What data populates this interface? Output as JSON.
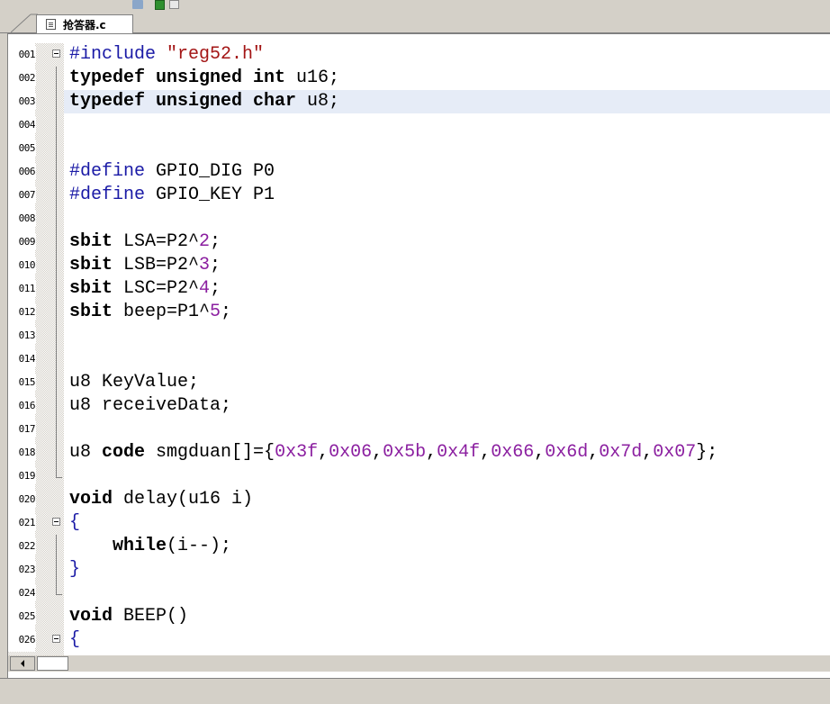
{
  "editor": {
    "tab_label": "抢答器.c",
    "highlighted_line": 3,
    "lines": [
      {
        "num": "001",
        "fold": "box",
        "parts": [
          {
            "t": "#include ",
            "c": "pp"
          },
          {
            "t": "\"reg52.h\"",
            "c": "str"
          }
        ]
      },
      {
        "num": "002",
        "fold": "line",
        "parts": [
          {
            "t": "typedef unsigned int ",
            "c": "kw"
          },
          {
            "t": "u16;",
            "c": ""
          }
        ]
      },
      {
        "num": "003",
        "fold": "line",
        "parts": [
          {
            "t": "typedef unsigned char ",
            "c": "kw"
          },
          {
            "t": "u8;",
            "c": ""
          }
        ]
      },
      {
        "num": "004",
        "fold": "line",
        "parts": []
      },
      {
        "num": "005",
        "fold": "line",
        "parts": []
      },
      {
        "num": "006",
        "fold": "line",
        "parts": [
          {
            "t": "#define ",
            "c": "pp"
          },
          {
            "t": "GPIO_DIG P0",
            "c": ""
          }
        ]
      },
      {
        "num": "007",
        "fold": "line",
        "parts": [
          {
            "t": "#define ",
            "c": "pp"
          },
          {
            "t": "GPIO_KEY P1",
            "c": ""
          }
        ]
      },
      {
        "num": "008",
        "fold": "line",
        "parts": []
      },
      {
        "num": "009",
        "fold": "line",
        "parts": [
          {
            "t": "sbit ",
            "c": "kw"
          },
          {
            "t": "LSA=P2^",
            "c": ""
          },
          {
            "t": "2",
            "c": "num"
          },
          {
            "t": ";",
            "c": ""
          }
        ]
      },
      {
        "num": "010",
        "fold": "line",
        "parts": [
          {
            "t": "sbit ",
            "c": "kw"
          },
          {
            "t": "LSB=P2^",
            "c": ""
          },
          {
            "t": "3",
            "c": "num"
          },
          {
            "t": ";",
            "c": ""
          }
        ]
      },
      {
        "num": "011",
        "fold": "line",
        "parts": [
          {
            "t": "sbit ",
            "c": "kw"
          },
          {
            "t": "LSC=P2^",
            "c": ""
          },
          {
            "t": "4",
            "c": "num"
          },
          {
            "t": ";",
            "c": ""
          }
        ]
      },
      {
        "num": "012",
        "fold": "line",
        "parts": [
          {
            "t": "sbit ",
            "c": "kw"
          },
          {
            "t": "beep=P1^",
            "c": ""
          },
          {
            "t": "5",
            "c": "num"
          },
          {
            "t": ";",
            "c": ""
          }
        ]
      },
      {
        "num": "013",
        "fold": "line",
        "parts": []
      },
      {
        "num": "014",
        "fold": "line",
        "parts": []
      },
      {
        "num": "015",
        "fold": "line",
        "parts": [
          {
            "t": "u8 KeyValue;",
            "c": ""
          }
        ]
      },
      {
        "num": "016",
        "fold": "line",
        "parts": [
          {
            "t": "u8 receiveData;",
            "c": ""
          }
        ]
      },
      {
        "num": "017",
        "fold": "line",
        "parts": []
      },
      {
        "num": "018",
        "fold": "line",
        "parts": [
          {
            "t": "u8 ",
            "c": ""
          },
          {
            "t": "code ",
            "c": "kw"
          },
          {
            "t": "smgduan[]={",
            "c": ""
          },
          {
            "t": "0x3f",
            "c": "num"
          },
          {
            "t": ",",
            "c": ""
          },
          {
            "t": "0x06",
            "c": "num"
          },
          {
            "t": ",",
            "c": ""
          },
          {
            "t": "0x5b",
            "c": "num"
          },
          {
            "t": ",",
            "c": ""
          },
          {
            "t": "0x4f",
            "c": "num"
          },
          {
            "t": ",",
            "c": ""
          },
          {
            "t": "0x66",
            "c": "num"
          },
          {
            "t": ",",
            "c": ""
          },
          {
            "t": "0x6d",
            "c": "num"
          },
          {
            "t": ",",
            "c": ""
          },
          {
            "t": "0x7d",
            "c": "num"
          },
          {
            "t": ",",
            "c": ""
          },
          {
            "t": "0x07",
            "c": "num"
          },
          {
            "t": "};",
            "c": ""
          }
        ]
      },
      {
        "num": "019",
        "fold": "end",
        "parts": []
      },
      {
        "num": "020",
        "fold": "none",
        "parts": [
          {
            "t": "void ",
            "c": "kw"
          },
          {
            "t": "delay(u16 i)",
            "c": ""
          }
        ]
      },
      {
        "num": "021",
        "fold": "box",
        "parts": [
          {
            "t": "{",
            "c": "op"
          }
        ]
      },
      {
        "num": "022",
        "fold": "line",
        "parts": [
          {
            "t": "    ",
            "c": ""
          },
          {
            "t": "while",
            "c": "kw"
          },
          {
            "t": "(i--);",
            "c": ""
          }
        ]
      },
      {
        "num": "023",
        "fold": "line",
        "parts": [
          {
            "t": "}",
            "c": "op"
          }
        ]
      },
      {
        "num": "024",
        "fold": "end",
        "parts": []
      },
      {
        "num": "025",
        "fold": "none",
        "parts": [
          {
            "t": "void ",
            "c": "kw"
          },
          {
            "t": "BEEP()",
            "c": ""
          }
        ]
      },
      {
        "num": "026",
        "fold": "box",
        "parts": [
          {
            "t": "{",
            "c": "op"
          }
        ]
      }
    ]
  },
  "colors": {
    "keyword": "#000000",
    "preprocessor": "#1a1aa6",
    "string": "#a31515",
    "number": "#8b1fa0",
    "line_highlight": "#e6ecf7"
  }
}
